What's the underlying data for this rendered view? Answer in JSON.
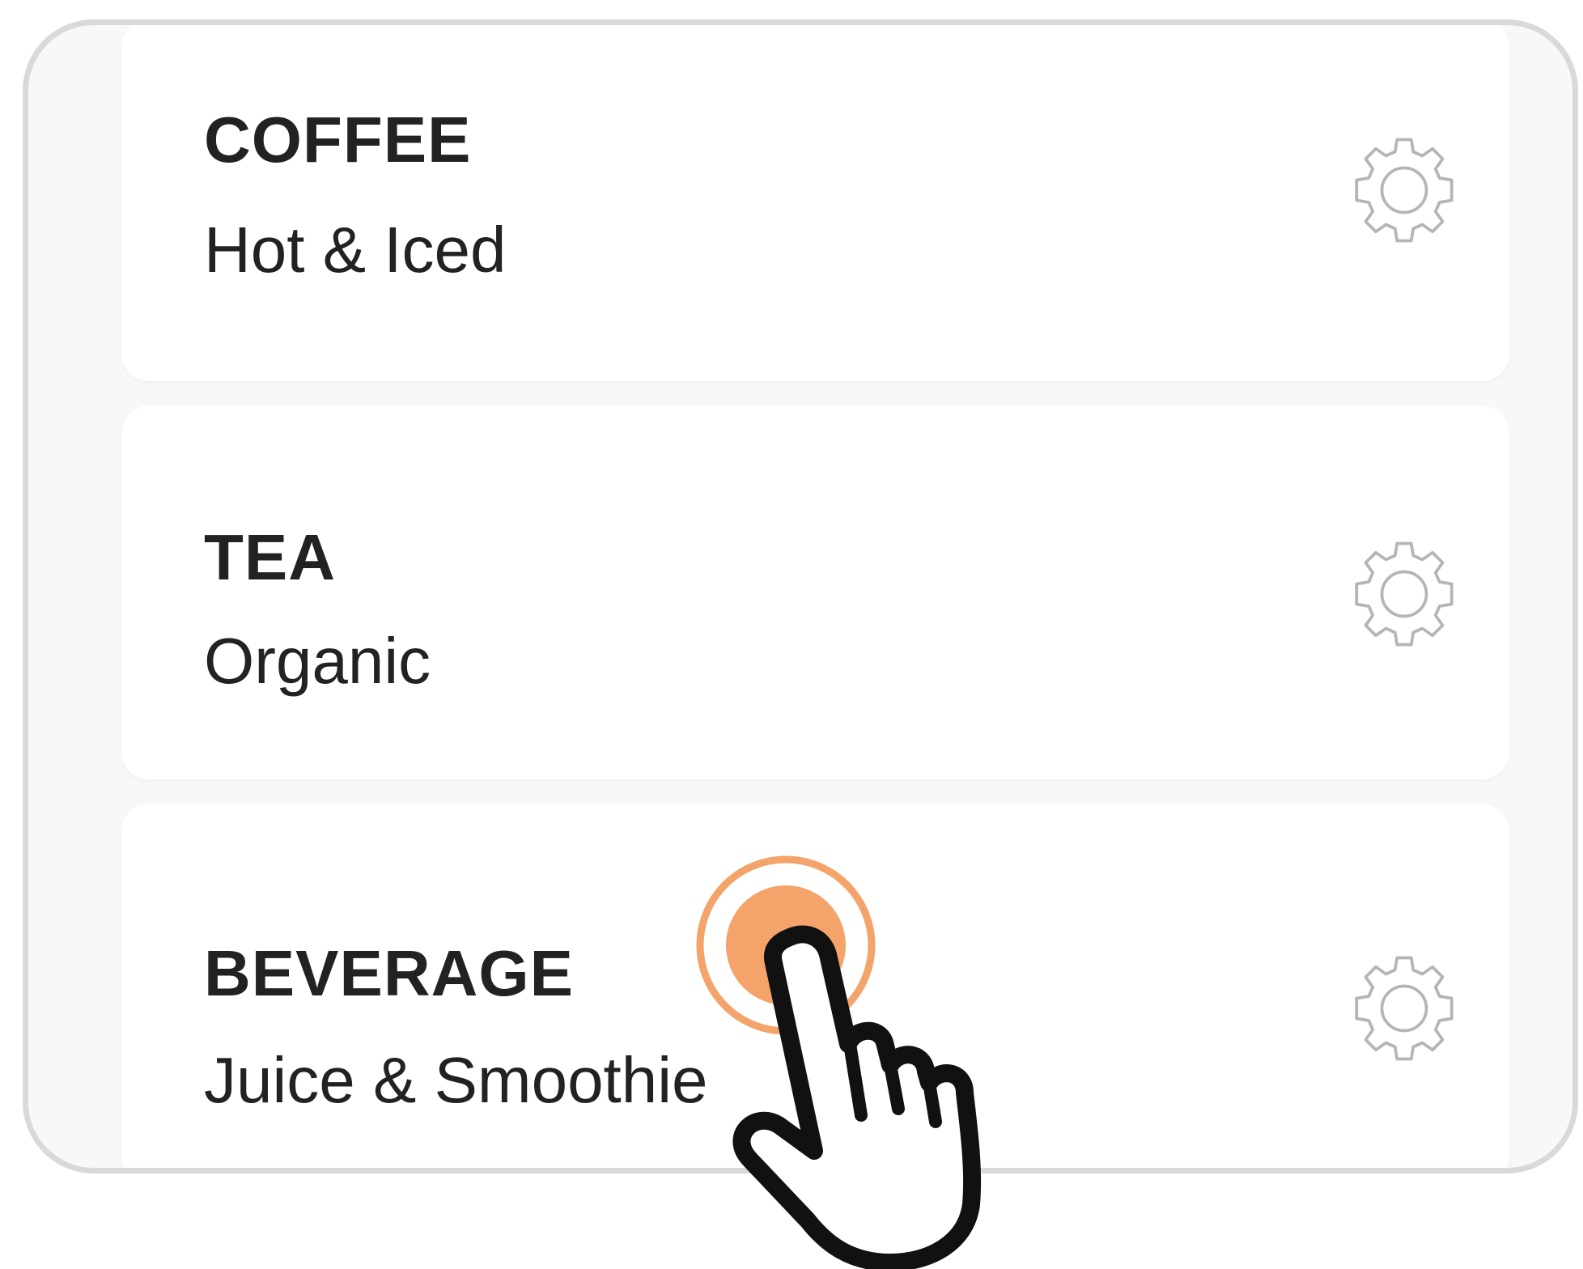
{
  "categories": [
    {
      "title": "COFFEE",
      "subtitle": "Hot & Iced",
      "icon": "gear-icon"
    },
    {
      "title": "TEA",
      "subtitle": "Organic",
      "icon": "gear-icon"
    },
    {
      "title": "BEVERAGE",
      "subtitle": "Juice & Smoothie",
      "icon": "gear-icon"
    }
  ],
  "colors": {
    "frame_border": "#d9d9d9",
    "card_background": "#ffffff",
    "text": "#222222",
    "gear_stroke": "#b5b5b5",
    "tap_accent": "#f4a36b"
  },
  "overlay": {
    "tap_target": "categories.2",
    "pointer_icon": "hand-pointer-icon",
    "tap_icon": "tap-ripple-icon"
  }
}
